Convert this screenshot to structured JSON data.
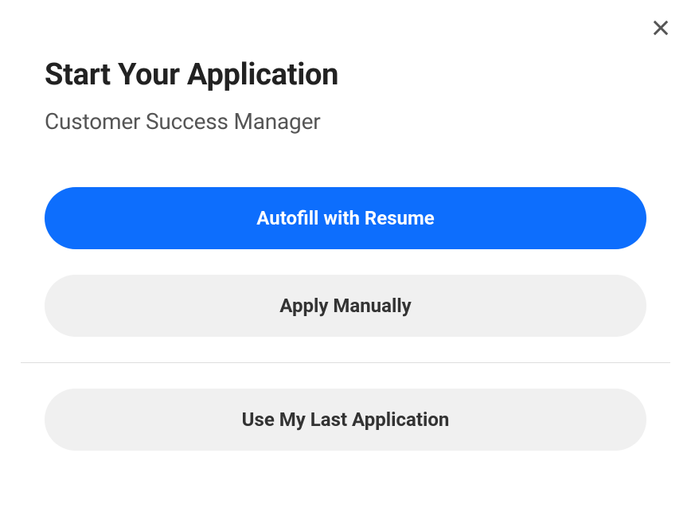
{
  "modal": {
    "title": "Start Your Application",
    "subtitle": "Customer Success Manager",
    "actions": {
      "autofill": "Autofill with Resume",
      "manual": "Apply Manually",
      "last": "Use My Last Application"
    }
  }
}
